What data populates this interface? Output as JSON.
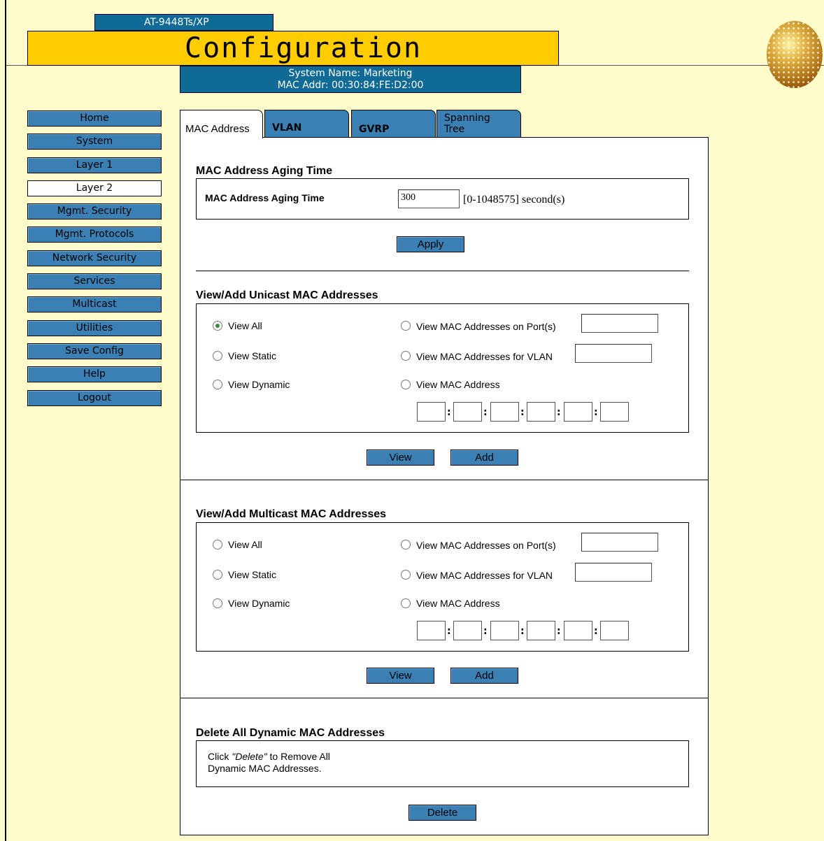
{
  "header": {
    "model": "AT-9448Ts/XP",
    "title": "Configuration",
    "system_name": "System Name: Marketing",
    "mac_addr": "MAC Addr: 00:30:84:FE:D2:00"
  },
  "nav": [
    {
      "label": "Home",
      "active": false
    },
    {
      "label": "System",
      "active": false
    },
    {
      "label": "Layer 1",
      "active": false
    },
    {
      "label": "Layer 2",
      "active": true
    },
    {
      "label": "Mgmt. Security",
      "active": false
    },
    {
      "label": "Mgmt. Protocols",
      "active": false
    },
    {
      "label": "Network Security",
      "active": false
    },
    {
      "label": "Services",
      "active": false
    },
    {
      "label": "Multicast",
      "active": false
    },
    {
      "label": "Utilities",
      "active": false
    },
    {
      "label": "Save Config",
      "active": false
    },
    {
      "label": "Help",
      "active": false
    },
    {
      "label": "Logout",
      "active": false
    }
  ],
  "tabs": {
    "mac": "MAC Address",
    "vlan": "VLAN",
    "gvrp": "GVRP",
    "stp_line1": "Spanning",
    "stp_line2": "Tree"
  },
  "aging": {
    "section_title": "MAC Address Aging Time",
    "field_label": "MAC Address Aging Time",
    "value": "300",
    "range": "[0-1048575] second(s)",
    "apply": "Apply"
  },
  "unicast": {
    "section_title": "View/Add Unicast MAC Addresses",
    "view_all": "View All",
    "view_static": "View Static",
    "view_dynamic": "View Dynamic",
    "view_ports": "View MAC Addresses on Port(s)",
    "view_vlan": "View MAC Addresses for VLAN",
    "view_mac": "View MAC Address",
    "view_btn": "View",
    "add_btn": "Add"
  },
  "multicast": {
    "section_title": "View/Add Multicast MAC Addresses",
    "view_all": "View All",
    "view_static": "View Static",
    "view_dynamic": "View Dynamic",
    "view_ports": "View MAC Addresses on Port(s)",
    "view_vlan": "View MAC Addresses for VLAN",
    "view_mac": "View MAC Address",
    "view_btn": "View",
    "add_btn": "Add"
  },
  "delete": {
    "section_title": "Delete All Dynamic MAC Addresses",
    "text_pre": "Click ",
    "text_em": "\"Delete\"",
    "text_post": " to Remove All",
    "text_line2": "Dynamic MAC Addresses.",
    "button": "Delete"
  }
}
